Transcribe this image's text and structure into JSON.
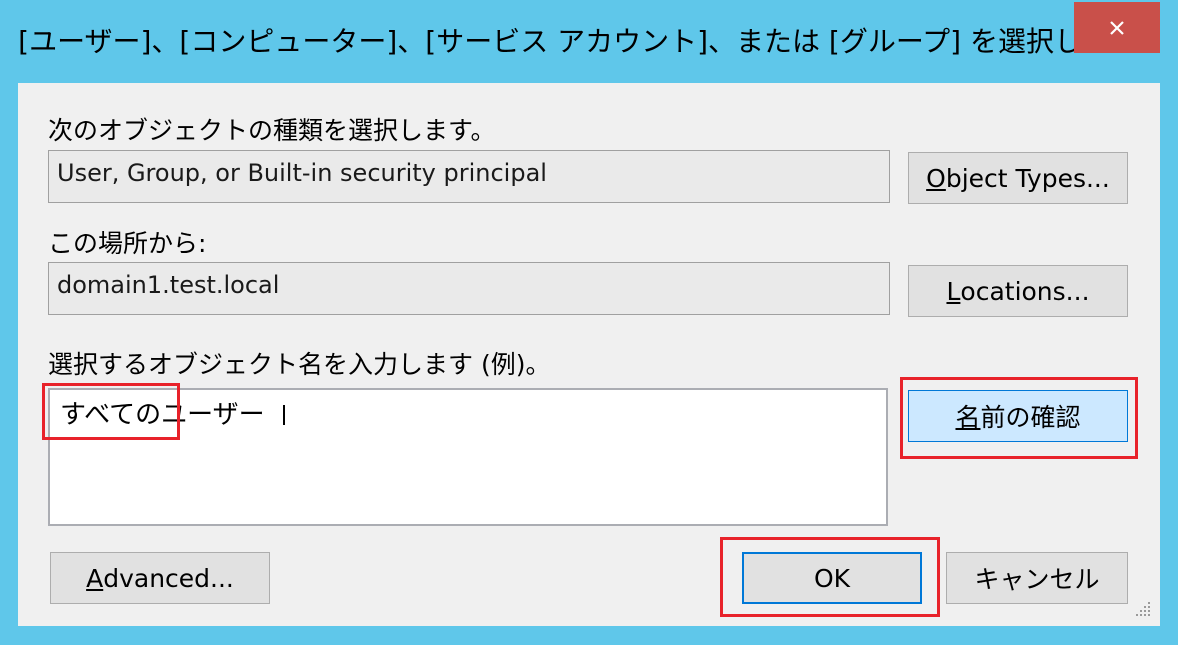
{
  "window": {
    "title": "[ユーザー]、[コンピューター]、[サービス アカウント]、または [グループ] を選択します"
  },
  "object_types": {
    "label": "次のオブジェクトの種類を選択します。",
    "value": "User, Group, or Built-in security principal",
    "button_accel": "O",
    "button_rest": "bject Types..."
  },
  "location": {
    "label": "この場所から:",
    "value": "domain1.test.local",
    "button_accel": "L",
    "button_rest": "ocations..."
  },
  "names": {
    "label": "選択するオブジェクト名を入力します (例)。",
    "value": "すべてのユーザー",
    "check_accel": "名",
    "check_rest": "前の確認"
  },
  "advanced": {
    "accel": "A",
    "rest": "dvanced..."
  },
  "ok_label": "OK",
  "cancel_label": "キャンセル",
  "colors": {
    "frame": "#5fc7ea",
    "close": "#c9504a",
    "highlight": "#e8222a",
    "focus": "#0078d7",
    "hover": "#cce8ff"
  }
}
